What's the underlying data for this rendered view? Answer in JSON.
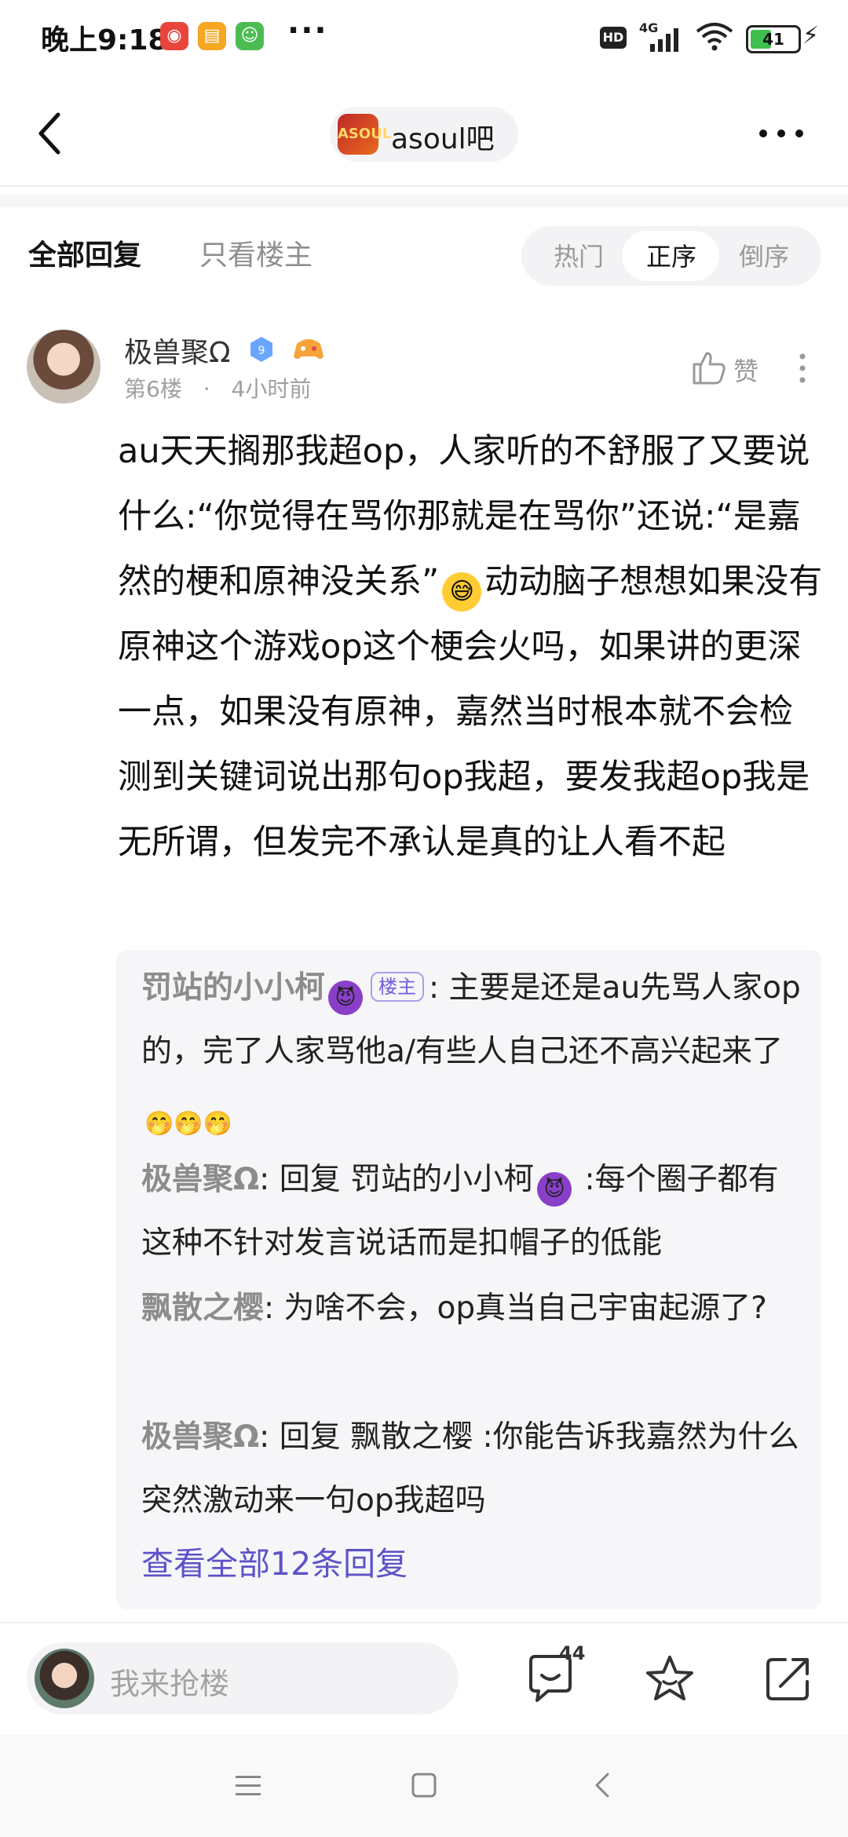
{
  "status_bar": {
    "time": "晚上9:18",
    "more": "···",
    "network_badge": "HD",
    "signal_label": "4G",
    "battery": "41"
  },
  "nav": {
    "forum_name": "asoul吧",
    "forum_logo_text": "ASOUL"
  },
  "filters": {
    "all_replies": "全部回复",
    "owner_only": "只看楼主",
    "sort_hot": "热门",
    "sort_asc": "正序",
    "sort_desc": "倒序",
    "active_sort": "正序"
  },
  "post": {
    "username": "极兽聚Ω",
    "level": "9",
    "floor": "第6楼",
    "separator": "·",
    "time": "4小时前",
    "like_label": "赞",
    "body_part1": "au天天搁那我超op，人家听的不舒服了又要说什么:“你觉得在骂你那就是在骂你”还说:“是嘉然的梗和原神没关系”",
    "body_emoji": "😅",
    "body_part2": "动动脑子想想如果没有原神这个游戏op这个梗会火吗，如果讲的更深一点，如果没有原神，嘉然当时根本就不会检测到关键词说出那句op我超，要发我超op我是无所谓，但发完不承认是真的让人看不起"
  },
  "sub_replies": {
    "r1_name": "罚站的小小柯",
    "r1_name_emoji": "😈",
    "r1_tag": "楼主",
    "r1_text": ": 主要是还是au先骂人家op的，完了人家骂他a/有些人自己还不高兴起来了",
    "r1_emojis": "🤭🤭🤭",
    "r2_name": "极兽聚Ω",
    "r2_text_a": ": 回复 罚站的小小柯",
    "r2_emoji": "😈",
    "r2_text_b": " :每个圈子都有这种不针对发言说话而是扣帽子的低能",
    "r3_name": "飘散之樱",
    "r3_text": ": 为啥不会，op真当自己宇宙起源了?",
    "r4_name": "极兽聚Ω",
    "r4_text": ": 回复 飘散之樱 :你能告诉我嘉然为什么突然激动来一句op我超吗",
    "view_all": "查看全部12条回复"
  },
  "bottom_bar": {
    "input_placeholder": "我来抢楼",
    "comment_count": "44"
  },
  "colors": {
    "accent": "#5e52c8",
    "owner_tag": "#6e5fd6",
    "muted": "#9a9a9a"
  },
  "icons": [
    "back-chevron-icon",
    "more-icon",
    "level-badge-icon",
    "game-icon",
    "thumbs-up-icon",
    "comment-icon",
    "star-icon",
    "share-icon",
    "menu-icon",
    "home-square-icon",
    "back-triangle-icon"
  ]
}
